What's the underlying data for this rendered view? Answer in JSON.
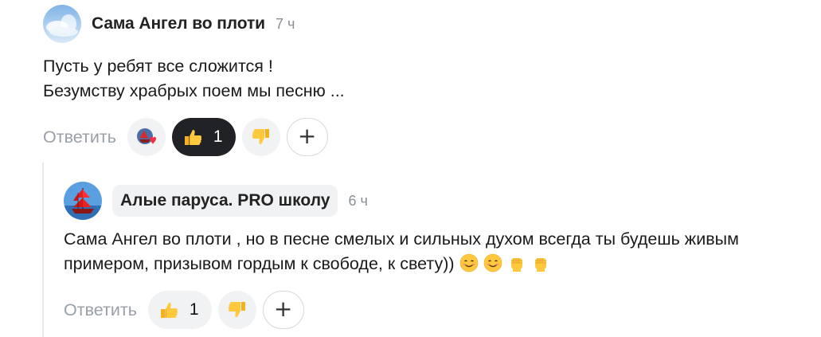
{
  "comments": [
    {
      "author": "Сама Ангел во плоти",
      "time": "7 ч",
      "text": "Пусть у ребят все сложится !\nБезумству храбрых поем мы песню ...",
      "reply_label": "Ответить",
      "likes": "1",
      "avatar": "angel-avatar"
    },
    {
      "author": "Алые паруса. PRO школу",
      "time": "6 ч",
      "text": "Сама Ангел во плоти , но в песне смелых и сильных духом всегда ты будешь живым примером, призывом гордым к свободе, к свету))",
      "reply_label": "Ответить",
      "likes": "1",
      "avatar": "red-sail-ship-avatar",
      "trailing_emojis": [
        "smiling-face",
        "smiling-face",
        "raised-fist",
        "raised-fist"
      ]
    }
  ],
  "colors": {
    "active_reaction_bg": "#202226",
    "pill_bg": "#f1f2f4",
    "muted_text": "#9aa0a8",
    "time_text": "#8a8f97"
  }
}
